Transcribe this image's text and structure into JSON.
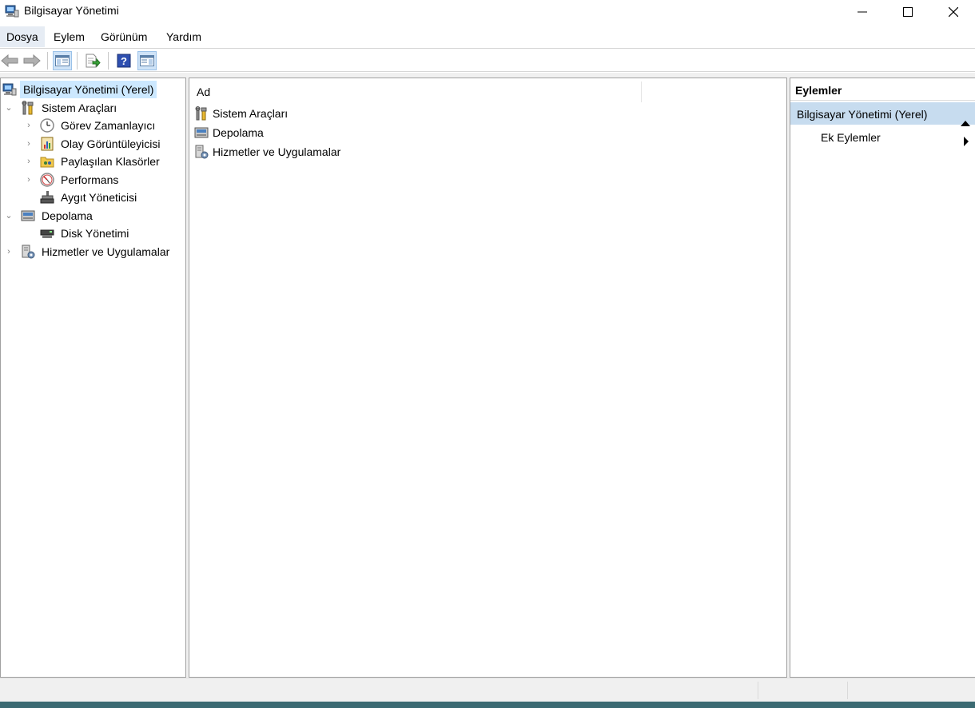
{
  "window": {
    "title": "Bilgisayar Yönetimi",
    "icon": "computer-management-icon"
  },
  "menu": {
    "items": [
      {
        "label": "Dosya",
        "active": true
      },
      {
        "label": "Eylem",
        "active": false
      },
      {
        "label": "Görünüm",
        "active": false
      },
      {
        "label": "Yardım",
        "active": false
      }
    ]
  },
  "toolbar": {
    "buttons": [
      "back-arrow-icon",
      "forward-arrow-icon",
      "show-hide-console-tree-icon",
      "export-list-icon",
      "help-icon",
      "show-hide-action-pane-icon"
    ]
  },
  "tree": {
    "root": {
      "label": "Bilgisayar Yönetimi (Yerel)",
      "icon": "computer-management-icon",
      "selected": true
    },
    "items": [
      {
        "label": "Sistem Araçları",
        "icon": "system-tools-icon",
        "expanded": true
      },
      {
        "label": "Görev Zamanlayıcı",
        "icon": "clock-icon"
      },
      {
        "label": "Olay Görüntüleyicisi",
        "icon": "event-viewer-icon"
      },
      {
        "label": "Paylaşılan Klasörler",
        "icon": "shared-folders-icon"
      },
      {
        "label": "Performans",
        "icon": "performance-icon"
      },
      {
        "label": "Aygıt Yöneticisi",
        "icon": "device-manager-icon"
      },
      {
        "label": "Depolama",
        "icon": "storage-icon",
        "expanded": true
      },
      {
        "label": "Disk Yönetimi",
        "icon": "disk-management-icon"
      },
      {
        "label": "Hizmetler ve Uygulamalar",
        "icon": "services-applications-icon"
      }
    ]
  },
  "list": {
    "column_header": "Ad",
    "rows": [
      {
        "label": "Sistem Araçları",
        "icon": "system-tools-icon"
      },
      {
        "label": "Depolama",
        "icon": "storage-icon"
      },
      {
        "label": "Hizmetler ve Uygulamalar",
        "icon": "services-applications-icon"
      }
    ]
  },
  "actions": {
    "header": "Eylemler",
    "section_title": "Bilgisayar Yönetimi (Yerel)",
    "item": "Ek Eylemler"
  },
  "colors": {
    "selection": "#cce8ff",
    "actions_section": "#c7dcef",
    "menu_active": "#e6ecf4"
  }
}
